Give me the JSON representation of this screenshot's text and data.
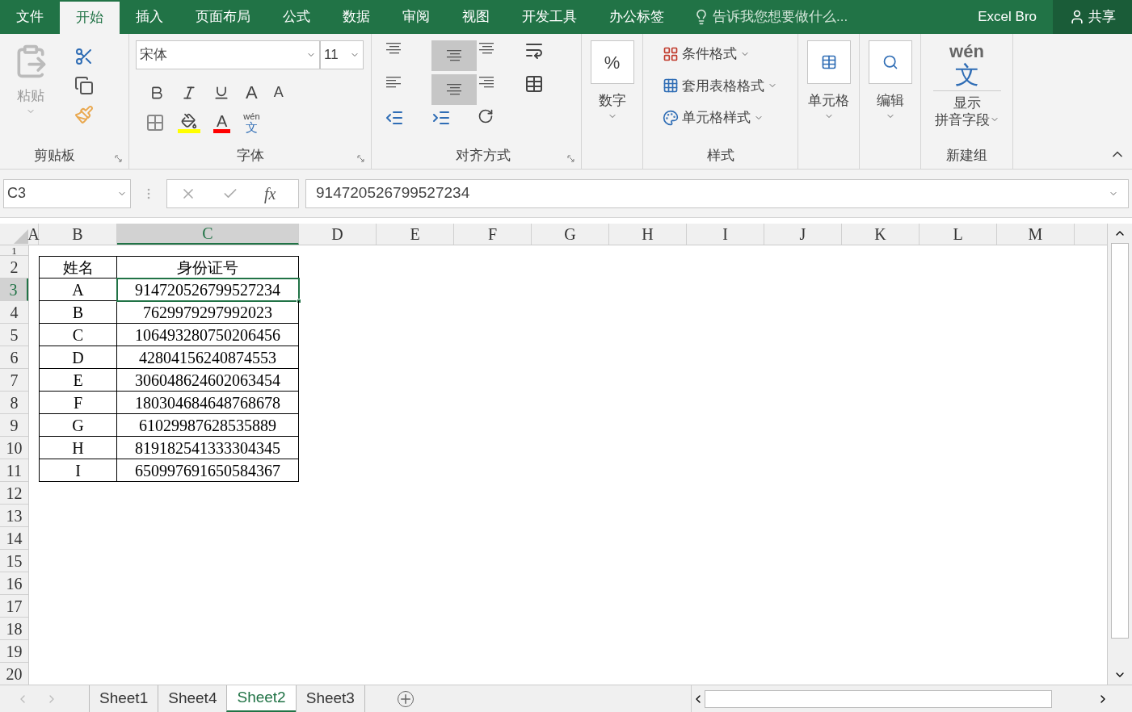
{
  "menu_tabs": [
    {
      "label": "文件",
      "selected": false
    },
    {
      "label": "开始",
      "selected": true
    },
    {
      "label": "插入",
      "selected": false
    },
    {
      "label": "页面布局",
      "selected": false
    },
    {
      "label": "公式",
      "selected": false
    },
    {
      "label": "数据",
      "selected": false
    },
    {
      "label": "审阅",
      "selected": false
    },
    {
      "label": "视图",
      "selected": false
    },
    {
      "label": "开发工具",
      "selected": false
    },
    {
      "label": "办公标签",
      "selected": false
    }
  ],
  "tell_me": "告诉我您想要做什么...",
  "user": "Excel Bro",
  "share": "共享",
  "ribbon": {
    "clipboard": {
      "paste": "粘贴",
      "title": "剪贴板"
    },
    "font": {
      "name": "宋体",
      "size": "11",
      "grow": "A",
      "shrink": "A",
      "color_letter": "A",
      "phonetic": "wén",
      "phonetic_char": "文",
      "title": "字体"
    },
    "alignment": {
      "title": "对齐方式"
    },
    "number": {
      "label": "数字",
      "symbol": "%"
    },
    "styles": {
      "items": [
        "条件格式",
        "套用表格格式",
        "单元格样式"
      ],
      "title": "样式"
    },
    "cells": {
      "label": "单元格"
    },
    "editing": {
      "label": "编辑"
    },
    "new_group": {
      "phonetic": "wén",
      "phonetic_char": "文",
      "line1": "显示",
      "line2": "拼音字段",
      "title": "新建组"
    }
  },
  "name_box": "C3",
  "fx": "fx",
  "formula": "914720526799527234",
  "columns": [
    {
      "label": "A",
      "selected": false
    },
    {
      "label": "B",
      "selected": false
    },
    {
      "label": "C",
      "selected": true
    },
    {
      "label": "D",
      "selected": false
    },
    {
      "label": "E",
      "selected": false
    },
    {
      "label": "F",
      "selected": false
    },
    {
      "label": "G",
      "selected": false
    },
    {
      "label": "H",
      "selected": false
    },
    {
      "label": "I",
      "selected": false
    },
    {
      "label": "J",
      "selected": false
    },
    {
      "label": "K",
      "selected": false
    },
    {
      "label": "L",
      "selected": false
    },
    {
      "label": "M",
      "selected": false
    }
  ],
  "rows": [
    {
      "label": "1",
      "selected": false
    },
    {
      "label": "2",
      "selected": false
    },
    {
      "label": "3",
      "selected": true
    },
    {
      "label": "4",
      "selected": false
    },
    {
      "label": "5",
      "selected": false
    },
    {
      "label": "6",
      "selected": false
    },
    {
      "label": "7",
      "selected": false
    },
    {
      "label": "8",
      "selected": false
    },
    {
      "label": "9",
      "selected": false
    },
    {
      "label": "10",
      "selected": false
    },
    {
      "label": "11",
      "selected": false
    },
    {
      "label": "12",
      "selected": false
    },
    {
      "label": "13",
      "selected": false
    },
    {
      "label": "14",
      "selected": false
    },
    {
      "label": "15",
      "selected": false
    },
    {
      "label": "16",
      "selected": false
    },
    {
      "label": "17",
      "selected": false
    },
    {
      "label": "18",
      "selected": false
    },
    {
      "label": "19",
      "selected": false
    },
    {
      "label": "20",
      "selected": false
    }
  ],
  "table": {
    "header": [
      "姓名",
      "身份证号"
    ],
    "rows": [
      {
        "name": "A",
        "id": "914720526799527234",
        "selected": true
      },
      {
        "name": "B",
        "id": "7629979297992023",
        "selected": false
      },
      {
        "name": "C",
        "id": "106493280750206456",
        "selected": false
      },
      {
        "name": "D",
        "id": "42804156240874553",
        "selected": false
      },
      {
        "name": "E",
        "id": "306048624602063454",
        "selected": false
      },
      {
        "name": "F",
        "id": "180304684648768678",
        "selected": false
      },
      {
        "name": "G",
        "id": "61029987628535889",
        "selected": false
      },
      {
        "name": "H",
        "id": "819182541333304345",
        "selected": false
      },
      {
        "name": "I",
        "id": "650997691650584367",
        "selected": false
      }
    ]
  },
  "sheet_tabs": [
    {
      "label": "Sheet1",
      "selected": false
    },
    {
      "label": "Sheet4",
      "selected": false
    },
    {
      "label": "Sheet2",
      "selected": true
    },
    {
      "label": "Sheet3",
      "selected": false
    }
  ]
}
